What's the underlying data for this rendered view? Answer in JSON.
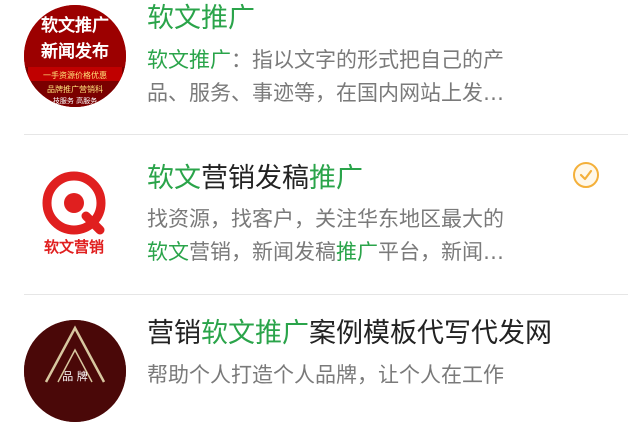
{
  "results": [
    {
      "avatar": {
        "line1": "软文推广",
        "line2": "新闻发布",
        "line3": "一手资源价格优惠",
        "line4": "品牌推广营销科",
        "line5": "技服务 高服务"
      },
      "title": {
        "parts": [
          "软文推广"
        ]
      },
      "desc": {
        "line1": [
          "软文推广",
          "：指以文字的形式把自己的产"
        ],
        "line2": [
          "品、服务、事迹等，在国内网站上发…"
        ]
      }
    },
    {
      "avatar": {
        "logo_text": "软文营销"
      },
      "title": {
        "parts": [
          "软文",
          "营销发稿",
          "推广"
        ]
      },
      "verified_icon": "verified-check-icon",
      "desc": {
        "line1": [
          "找资源，找客户，关注华东地区最大的"
        ],
        "line2": [
          "软文",
          "营销，新闻发稿",
          "推广",
          "平台，新闻…"
        ]
      }
    },
    {
      "avatar": {
        "small_text": "品 牌"
      },
      "title": {
        "parts": [
          "营销",
          "软文推广",
          "案例模板代写代发网"
        ]
      },
      "desc": {
        "line1": [
          "帮助个人打造个人品牌，让个人在工作"
        ]
      }
    }
  ],
  "colors": {
    "highlight": "#2aa44a",
    "text": "#222222",
    "muted": "#7a7a7a",
    "verified": "#f4b03a"
  }
}
